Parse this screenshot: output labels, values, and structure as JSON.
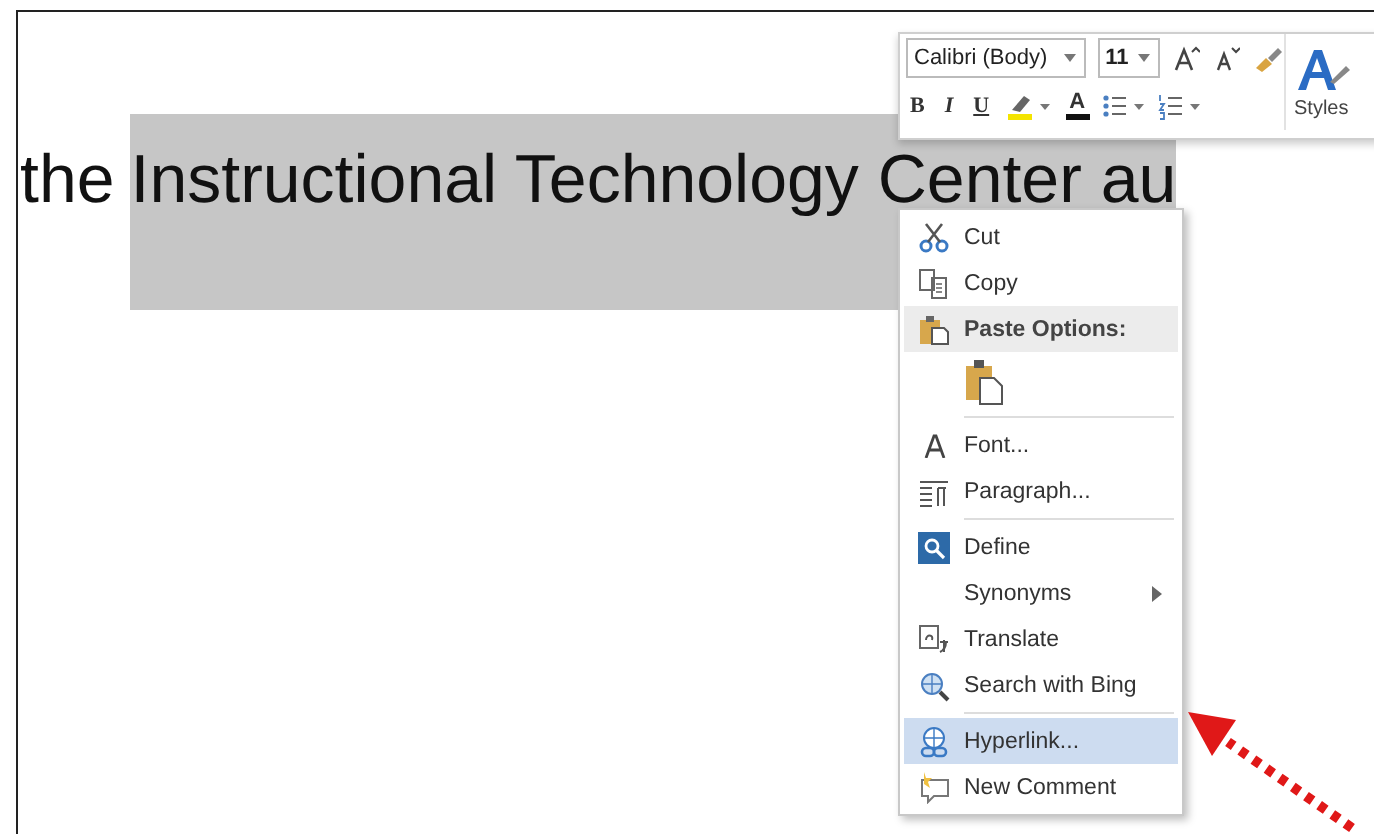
{
  "document": {
    "text_before": "the ",
    "selected_text": "Instructional Technology Center au"
  },
  "mini_toolbar": {
    "font_name": "Calibri (Body)",
    "font_size": "11",
    "bold": "B",
    "italic": "I",
    "underline": "U",
    "font_color": "A",
    "styles_label": "Styles"
  },
  "context_menu": {
    "items": [
      {
        "kind": "item",
        "label": "Cut",
        "selected": false,
        "submenu": false
      },
      {
        "kind": "item",
        "label": "Copy",
        "selected": false,
        "submenu": false
      },
      {
        "kind": "header",
        "label": "Paste Options:"
      },
      {
        "kind": "paste"
      },
      {
        "kind": "separator"
      },
      {
        "kind": "item",
        "label": "Font...",
        "selected": false,
        "submenu": false
      },
      {
        "kind": "item",
        "label": "Paragraph...",
        "selected": false,
        "submenu": false
      },
      {
        "kind": "separator"
      },
      {
        "kind": "item",
        "label": "Define",
        "selected": false,
        "submenu": false
      },
      {
        "kind": "item",
        "label": "Synonyms",
        "selected": false,
        "submenu": true
      },
      {
        "kind": "item",
        "label": "Translate",
        "selected": false,
        "submenu": false
      },
      {
        "kind": "item",
        "label": "Search with Bing",
        "selected": false,
        "submenu": false
      },
      {
        "kind": "separator"
      },
      {
        "kind": "item",
        "label": "Hyperlink...",
        "selected": true,
        "submenu": false
      },
      {
        "kind": "item",
        "label": "New Comment",
        "selected": false,
        "submenu": false
      }
    ]
  }
}
